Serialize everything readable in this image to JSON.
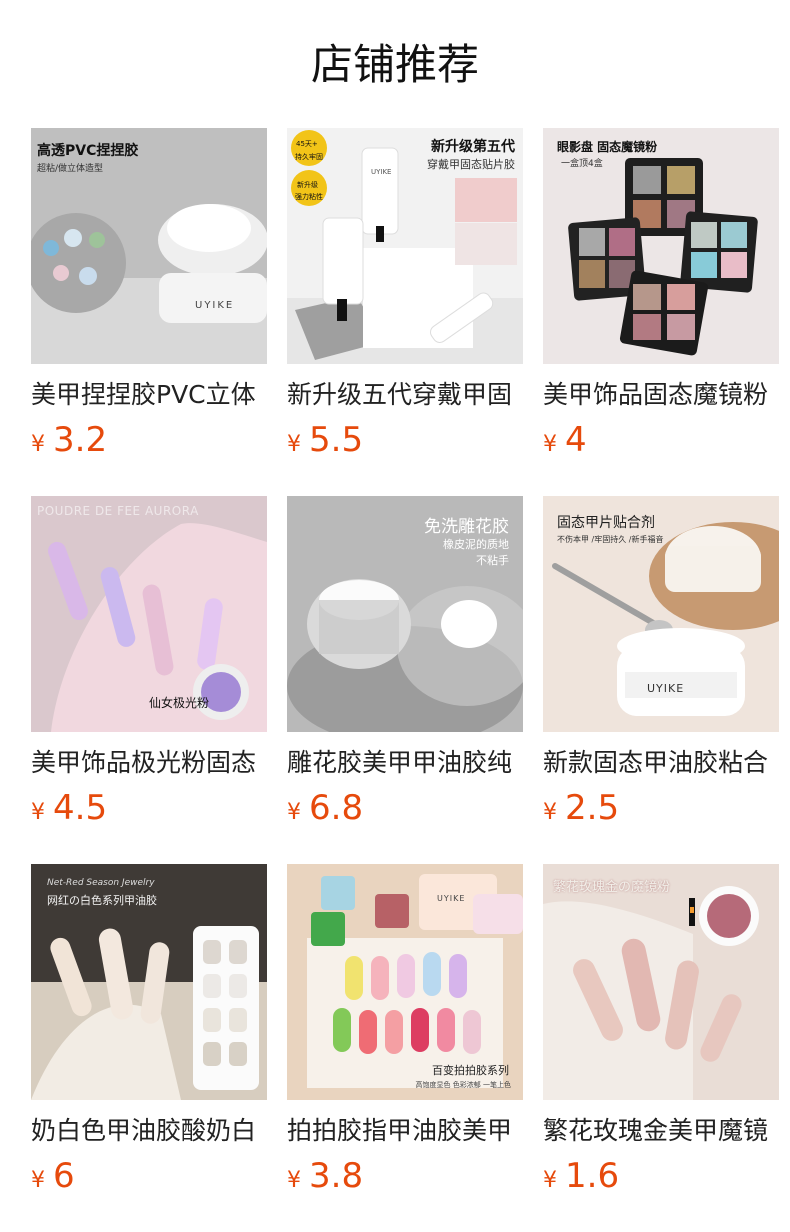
{
  "page": {
    "title": "店铺推荐",
    "currency_symbol": "¥"
  },
  "products": [
    {
      "name": "美甲捏捏胶PVC立体",
      "price": "3.2",
      "image_text": [
        "高透PVC捏捏胶",
        "超粘/做立体造型",
        "UYIKE"
      ]
    },
    {
      "name": "新升级五代穿戴甲固",
      "price": "5.5",
      "image_text": [
        "45天+",
        "持久牢固",
        "新升级",
        "强力粘性",
        "新升级第五代",
        "穿戴甲固态贴片胶",
        "UYIKE"
      ]
    },
    {
      "name": "美甲饰品固态魔镜粉",
      "price": "4",
      "image_text": [
        "眼影盘 固态魔镜粉",
        "一盒顶4盒"
      ]
    },
    {
      "name": "美甲饰品极光粉固态",
      "price": "4.5",
      "image_text": [
        "POUDRE DE FEE AURORA",
        "仙女极光粉"
      ]
    },
    {
      "name": "雕花胶美甲甲油胶纯",
      "price": "6.8",
      "image_text": [
        "免洗雕花胶",
        "橡皮泥的质地",
        "不粘手"
      ]
    },
    {
      "name": "新款固态甲油胶粘合",
      "price": "2.5",
      "image_text": [
        "固态甲片贴合剂",
        "不伤本甲 /牢固持久 /新手福音",
        "UYIKE"
      ]
    },
    {
      "name": "奶白色甲油胶酸奶白",
      "price": "6",
      "image_text": [
        "Net-Red Season Jewelry",
        "网红の白色系列甲油胶"
      ]
    },
    {
      "name": "拍拍胶指甲油胶美甲",
      "price": "3.8",
      "image_text": [
        "百变拍拍胶系列",
        "高饱度显色 色彩浓郁 一笔上色",
        "UYIKE"
      ]
    },
    {
      "name": "繁花玫瑰金美甲魔镜",
      "price": "1.6",
      "image_text": [
        "繁花玫瑰金の魔镜粉"
      ]
    }
  ]
}
